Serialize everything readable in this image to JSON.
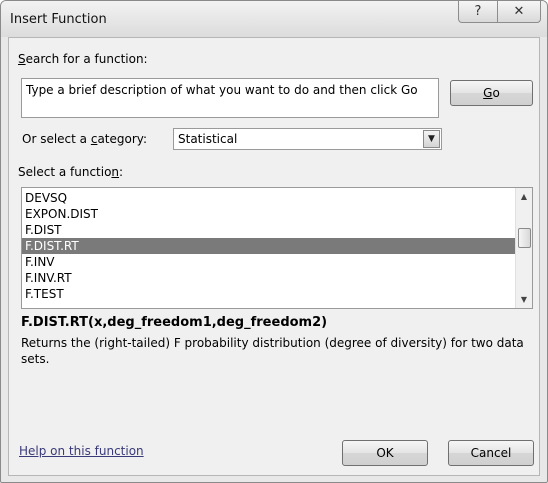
{
  "window": {
    "title": "Insert Function",
    "help_glyph": "?",
    "close_glyph": "✕"
  },
  "search": {
    "label_mnemonic": "S",
    "label_rest": "earch for a function:",
    "value": "Type a brief description of what you want to do and then click Go",
    "go_mnemonic": "G",
    "go_rest": "o"
  },
  "category": {
    "label_pre": "Or select a ",
    "label_mnemonic": "c",
    "label_post": "ategory:",
    "value": "Statistical"
  },
  "function_list": {
    "label_pre": "Select a functio",
    "label_mnemonic": "n",
    "label_post": ":",
    "items": [
      "DEVSQ",
      "EXPON.DIST",
      "F.DIST",
      "F.DIST.RT",
      "F.INV",
      "F.INV.RT",
      "F.TEST"
    ],
    "selected": "F.DIST.RT"
  },
  "details": {
    "signature": "F.DIST.RT(x,deg_freedom1,deg_freedom2)",
    "description": "Returns the (right-tailed) F probability distribution (degree of diversity) for two data sets."
  },
  "footer": {
    "help_link": "Help on this function",
    "ok_label": "OK",
    "cancel_label": "Cancel"
  }
}
